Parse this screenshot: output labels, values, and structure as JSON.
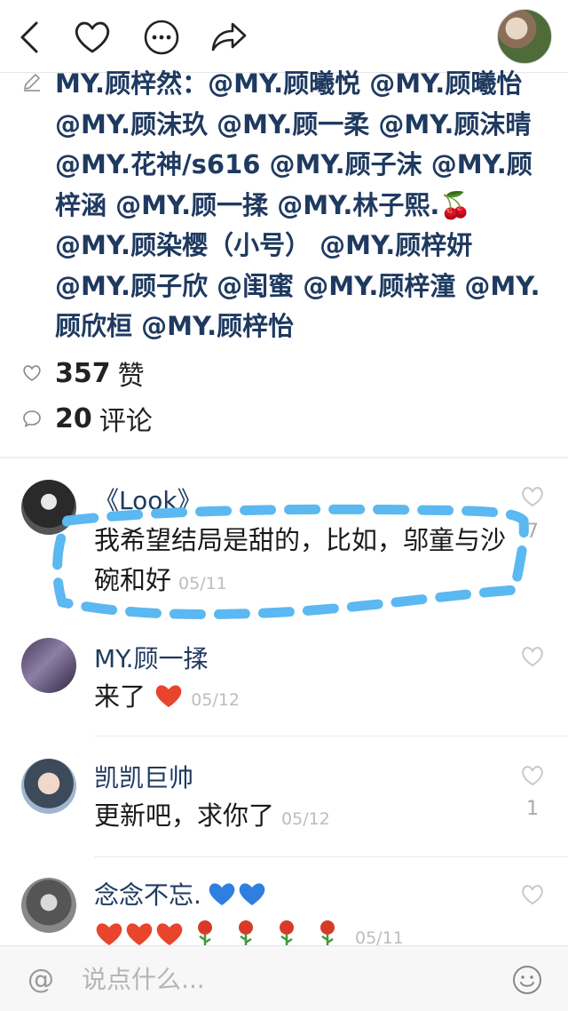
{
  "post": {
    "caption_author": "MY.顾梓然：",
    "caption_mentions": "@MY.顾曦悦 @MY.顾曦怡 @MY.顾沫玖 @MY.顾一柔 @MY.顾沫晴 @MY.花神/s616 @MY.顾子沫 @MY.顾梓涵 @MY.顾一揉 @MY.林子熙.🍒 @MY.顾染樱（小号） @MY.顾梓妍 @MY.顾子欣 @闺蜜 @MY.顾梓潼 @MY.顾欣桓 @MY.顾梓怡",
    "likes_count": "357",
    "likes_label": "赞",
    "comments_count": "20",
    "comments_label": "评论"
  },
  "comments": [
    {
      "name": "《Look》",
      "text": "我希望结局是甜的，比如，邬童与沙碗和好",
      "date": "05/11",
      "likes": "7"
    },
    {
      "name": "MY.顾一揉",
      "text": "来了",
      "date": "05/12",
      "likes": ""
    },
    {
      "name": "凯凯巨帅",
      "text": "更新吧，求你了",
      "date": "05/12",
      "likes": "1"
    },
    {
      "name": "念念不忘.",
      "text": "",
      "date": "05/11",
      "likes": ""
    }
  ],
  "input": {
    "placeholder": "说点什么..."
  },
  "colors": {
    "link": "#1f3a60",
    "annotation": "#5bb8f0",
    "heart": "#e8452c"
  },
  "icons": [
    "back-icon",
    "heart-icon",
    "more-icon",
    "share-icon",
    "pencil-icon",
    "like-icon",
    "comment-icon",
    "at-icon",
    "emoji-icon"
  ]
}
